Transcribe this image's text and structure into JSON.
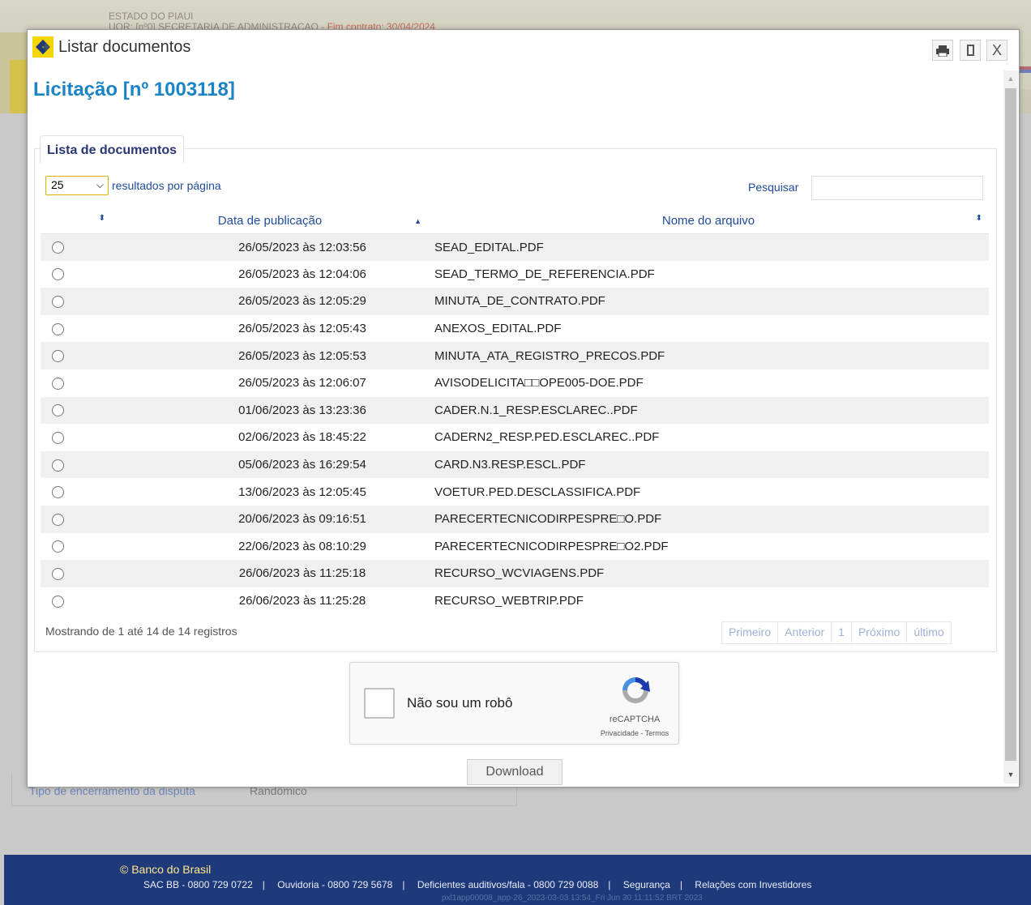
{
  "background": {
    "state": "ESTADO DO PIAUI",
    "uor_text": "UOR: [nº0] SECRETARIA DE ADMINISTRACAO -",
    "contract_text": "Fim contrato: 30/04/2024",
    "field_label": "Tipo de encerramento da disputa",
    "field_value": "Randômico"
  },
  "modal": {
    "title": "Listar documentos",
    "heading": "Licitação [nº 1003118]",
    "tab_label": "Lista de documentos",
    "page_length": "25",
    "page_length_label": "resultados por página",
    "search_label": "Pesquisar",
    "search_value": "",
    "columns": {
      "date": "Data de publicação",
      "name": "Nome do arquivo"
    },
    "rows": [
      {
        "date": "26/05/2023 às 12:03:56",
        "name": "SEAD_EDITAL.PDF"
      },
      {
        "date": "26/05/2023 às 12:04:06",
        "name": "SEAD_TERMO_DE_REFERENCIA.PDF"
      },
      {
        "date": "26/05/2023 às 12:05:29",
        "name": "MINUTA_DE_CONTRATO.PDF"
      },
      {
        "date": "26/05/2023 às 12:05:43",
        "name": "ANEXOS_EDITAL.PDF"
      },
      {
        "date": "26/05/2023 às 12:05:53",
        "name": "MINUTA_ATA_REGISTRO_PRECOS.PDF"
      },
      {
        "date": "26/05/2023 às 12:06:07",
        "name": "AVISODELICITA□□OPE005-DOE.PDF"
      },
      {
        "date": "01/06/2023 às 13:23:36",
        "name": "CADER.N.1_RESP.ESCLAREC..PDF"
      },
      {
        "date": "02/06/2023 às 18:45:22",
        "name": "CADERN2_RESP.PED.ESCLAREC..PDF"
      },
      {
        "date": "05/06/2023 às 16:29:54",
        "name": "CARD.N3.RESP.ESCL.PDF"
      },
      {
        "date": "13/06/2023 às 12:05:45",
        "name": "VOETUR.PED.DESCLASSIFICA.PDF"
      },
      {
        "date": "20/06/2023 às 09:16:51",
        "name": "PARECERTECNICODIRPESPRE□O.PDF"
      },
      {
        "date": "22/06/2023 às 08:10:29",
        "name": "PARECERTECNICODIRPESPRE□O2.PDF"
      },
      {
        "date": "26/06/2023 às 11:25:18",
        "name": "RECURSO_WCVIAGENS.PDF"
      },
      {
        "date": "26/06/2023 às 11:25:28",
        "name": "RECURSO_WEBTRIP.PDF"
      }
    ],
    "info": "Mostrando de 1 até 14 de 14 registros",
    "pager": {
      "first": "Primeiro",
      "prev": "Anterior",
      "current": "1",
      "next": "Próximo",
      "last": "último"
    },
    "captcha": {
      "label": "Não sou um robô",
      "brand": "reCAPTCHA",
      "terms": "Privacidade - Termos"
    },
    "download_label": "Download"
  },
  "footer": {
    "copyright": "© Banco do Brasil",
    "links": [
      "SAC BB - 0800 729 0722",
      "Ouvidoria - 0800 729 5678",
      "Deficientes auditivos/fala - 0800 729 0088",
      "Segurança",
      "Relações com Investidores"
    ],
    "build": "pxl1app00008_app-26_2023-03-03 13:54_Fri Jun 30 11:11:52 BRT 2023"
  },
  "colors": {
    "heading": "#1b84c7",
    "tab_text": "#2a3576",
    "link": "#1f4b9b",
    "footer_bg": "#1f3a7a",
    "select_border": "#d6b400"
  }
}
